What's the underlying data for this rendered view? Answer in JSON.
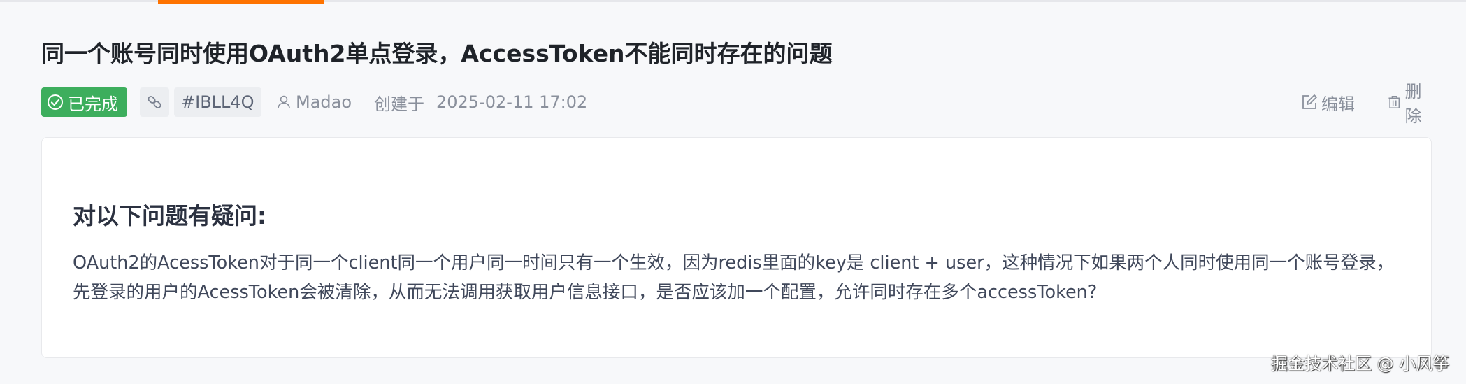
{
  "issue": {
    "title": "同一个账号同时使用OAuth2单点登录，AccessToken不能同时存在的问题",
    "status": "已完成",
    "id": "#IBLL4Q",
    "author": "Madao",
    "created_label": "创建于",
    "created_time": "2025-02-11 17:02"
  },
  "actions": {
    "edit_label": "编辑",
    "delete_label": "删除"
  },
  "content": {
    "heading": "对以下问题有疑问:",
    "body": "OAuth2的AcessToken对于同一个client同一个用户同一时间只有一个生效，因为redis里面的key是 client + user，这种情况下如果两个人同时使用同一个账号登录，先登录的用户的AcessToken会被清除，从而无法调用获取用户信息接口，是否应该加一个配置，允许同时存在多个accessToken?"
  },
  "watermark": "掘金技术社区 @ 小风筝",
  "colors": {
    "accent": "#fe7300",
    "status_green": "#3dae5d"
  },
  "icons": {
    "status": "check-circle-icon",
    "link": "link-icon",
    "author": "user-icon",
    "edit": "edit-icon",
    "delete": "trash-icon"
  }
}
